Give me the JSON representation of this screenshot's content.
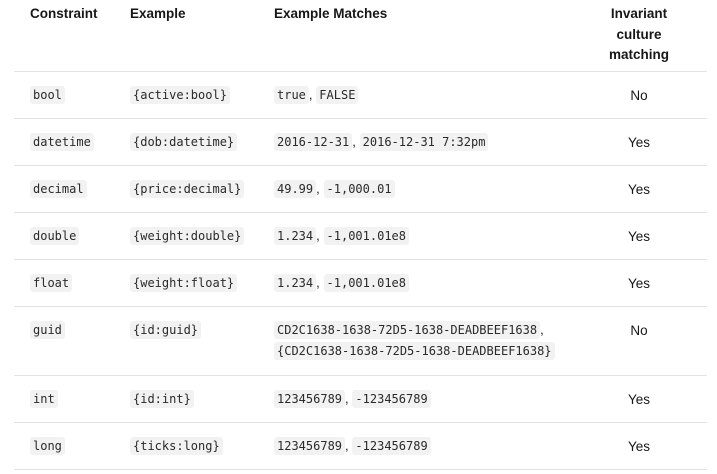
{
  "headers": {
    "constraint": "Constraint",
    "example": "Example",
    "matches": "Example Matches",
    "invariant_line1": "Invariant",
    "invariant_line2": "culture",
    "invariant_line3": "matching"
  },
  "rows": [
    {
      "constraint": "bool",
      "example": "{active:bool}",
      "m1": "true",
      "m2": "FALSE",
      "inv": "No"
    },
    {
      "constraint": "datetime",
      "example": "{dob:datetime}",
      "m1": "2016-12-31",
      "m2": "2016-12-31 7:32pm",
      "inv": "Yes"
    },
    {
      "constraint": "decimal",
      "example": "{price:decimal}",
      "m1": "49.99",
      "m2": "-1,000.01",
      "inv": "Yes"
    },
    {
      "constraint": "double",
      "example": "{weight:double}",
      "m1": "1.234",
      "m2": "-1,001.01e8",
      "inv": "Yes"
    },
    {
      "constraint": "float",
      "example": "{weight:float}",
      "m1": "1.234",
      "m2": "-1,001.01e8",
      "inv": "Yes"
    },
    {
      "constraint": "guid",
      "example": "{id:guid}",
      "m1": "CD2C1638-1638-72D5-1638-DEADBEEF1638",
      "m2": "{CD2C1638-1638-72D5-1638-DEADBEEF1638}",
      "inv": "No"
    },
    {
      "constraint": "int",
      "example": "{id:int}",
      "m1": "123456789",
      "m2": "-123456789",
      "inv": "Yes"
    },
    {
      "constraint": "long",
      "example": "{ticks:long}",
      "m1": "123456789",
      "m2": "-123456789",
      "inv": "Yes"
    }
  ],
  "separator": ","
}
